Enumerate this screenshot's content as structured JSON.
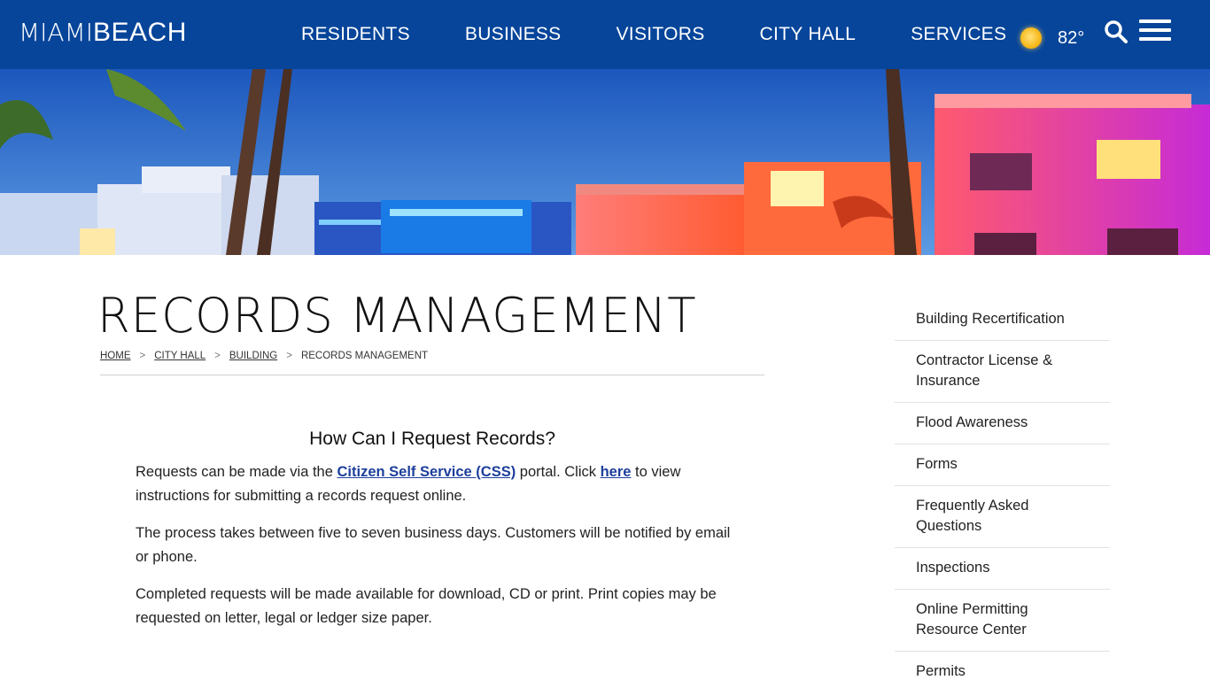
{
  "header": {
    "logo_light": "MIAMI",
    "logo_bold": "BEACH",
    "nav": [
      "RESIDENTS",
      "BUSINESS",
      "VISITORS",
      "CITY HALL",
      "SERVICES"
    ],
    "temperature": "82°",
    "weather_icon": "sun-icon",
    "search_icon": "search-icon",
    "menu_icon": "hamburger-menu-icon",
    "background_color": "#06459a"
  },
  "page": {
    "title": "RECORDS MANAGEMENT",
    "breadcrumb": {
      "home": "HOME",
      "city_hall": "CITY HALL",
      "building": "BUILDING",
      "current": "RECORDS MANAGEMENT",
      "separator": ">"
    }
  },
  "content": {
    "heading": "How Can I Request Records?",
    "p1_before": "Requests can be made via the ",
    "p1_link1": "Citizen Self Service (CSS)",
    "p1_middle": " portal.  Click ",
    "p1_link2": "here",
    "p1_after": " to view instructions for submitting a records request online.",
    "p2": "The process takes between five to seven business days.  Customers will be notified by email or phone.",
    "p3": "Completed requests will be made available for download, CD or print.  Print copies may be requested on letter, legal or ledger size paper.",
    "link_color": "#1d3f9c"
  },
  "sidebar": {
    "items": [
      "Building Recertification",
      "Contractor License & Insurance",
      "Flood Awareness",
      "Forms",
      "Frequently Asked Questions",
      "Inspections",
      "Online Permitting Resource Center",
      "Permits"
    ]
  }
}
